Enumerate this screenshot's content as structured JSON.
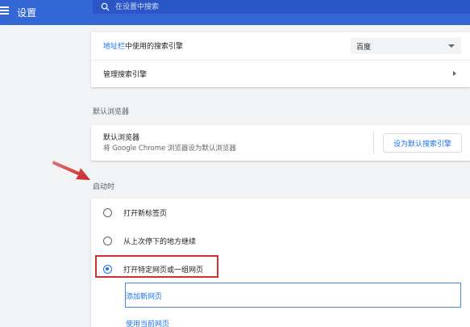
{
  "header": {
    "title": "设置",
    "search_placeholder": "在设置中搜索"
  },
  "search_engine": {
    "label_link": "地址栏",
    "label_rest": "中使用的搜索引擎",
    "selected": "百度",
    "manage_label": "管理搜索引擎"
  },
  "default_browser": {
    "section_title": "默认浏览器",
    "title": "默认浏览器",
    "subtitle": "将 Google Chrome 浏览器设为默认浏览器",
    "button_label": "设为默认搜索引擎"
  },
  "on_startup": {
    "section_title": "启动时",
    "options": [
      {
        "label": "打开新标签页",
        "checked": false
      },
      {
        "label": "从上次停下的地方继续",
        "checked": false
      },
      {
        "label": "打开特定网页或一组网页",
        "checked": true
      }
    ],
    "add_page": "添加新网页",
    "use_current": "使用当前网页"
  },
  "colors": {
    "header": "#3367d6",
    "accent": "#1a73e8",
    "highlight": "#d32f2f",
    "arrow": "#d32f2f"
  }
}
